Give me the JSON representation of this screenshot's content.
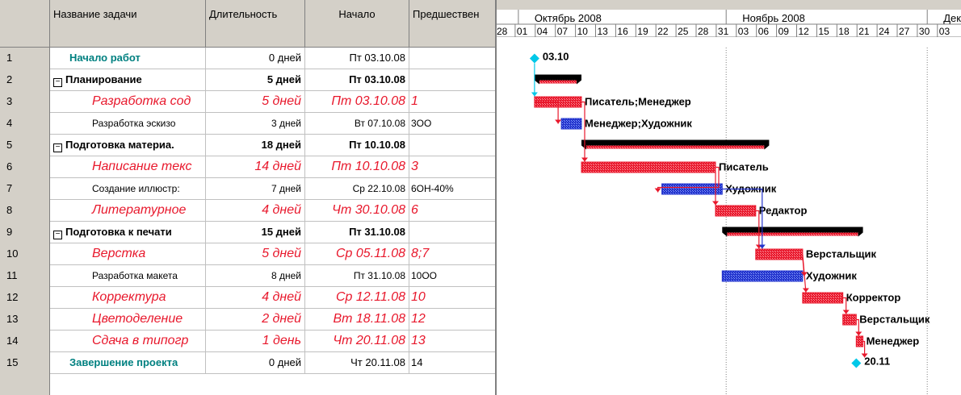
{
  "columns": {
    "name": "Название задачи",
    "duration": "Длительность",
    "start": "Начало",
    "predecessors": "Предшествен"
  },
  "tasks": [
    {
      "id": "1",
      "name": "Начало работ",
      "duration": "0 дней",
      "start": "Пт 03.10.08",
      "pred": "",
      "kind": "milestone"
    },
    {
      "id": "2",
      "name": "Планирование",
      "duration": "5 дней",
      "start": "Пт 03.10.08",
      "pred": "",
      "kind": "summary"
    },
    {
      "id": "3",
      "name": "Разработка сод",
      "duration": "5 дней",
      "start": "Пт 03.10.08",
      "pred": "1",
      "kind": "critical"
    },
    {
      "id": "4",
      "name": "Разработка эскизо",
      "duration": "3 дней",
      "start": "Вт 07.10.08",
      "pred": "3ОО",
      "kind": "normal"
    },
    {
      "id": "5",
      "name": "Подготовка материа.",
      "duration": "18 дней",
      "start": "Пт 10.10.08",
      "pred": "",
      "kind": "summary"
    },
    {
      "id": "6",
      "name": "Написание текс",
      "duration": "14 дней",
      "start": "Пт 10.10.08",
      "pred": "3",
      "kind": "critical"
    },
    {
      "id": "7",
      "name": "Создание иллюстр:",
      "duration": "7 дней",
      "start": "Ср 22.10.08",
      "pred": "6ОН-40%",
      "kind": "normal"
    },
    {
      "id": "8",
      "name": "Литературное",
      "duration": "4 дней",
      "start": "Чт 30.10.08",
      "pred": "6",
      "kind": "critical"
    },
    {
      "id": "9",
      "name": "Подготовка к печати",
      "duration": "15 дней",
      "start": "Пт 31.10.08",
      "pred": "",
      "kind": "summary"
    },
    {
      "id": "10",
      "name": "Верстка",
      "duration": "5 дней",
      "start": "Ср 05.11.08",
      "pred": "8;7",
      "kind": "critical"
    },
    {
      "id": "11",
      "name": "Разработка макета",
      "duration": "8 дней",
      "start": "Пт 31.10.08",
      "pred": "10ОО",
      "kind": "normal"
    },
    {
      "id": "12",
      "name": "Корректура",
      "duration": "4 дней",
      "start": "Ср 12.11.08",
      "pred": "10",
      "kind": "critical"
    },
    {
      "id": "13",
      "name": "Цветоделение",
      "duration": "2 дней",
      "start": "Вт 18.11.08",
      "pred": "12",
      "kind": "critical"
    },
    {
      "id": "14",
      "name": "Сдача в типогр",
      "duration": "1 день",
      "start": "Чт 20.11.08",
      "pred": "13",
      "kind": "critical"
    },
    {
      "id": "15",
      "name": "Завершение проекта",
      "duration": "0 дней",
      "start": "Чт 20.11.08",
      "pred": "14",
      "kind": "milestone"
    }
  ],
  "timescale": {
    "months": [
      "Октябрь 2008",
      "Ноябрь 2008",
      "Дек"
    ],
    "days": [
      "28",
      "01",
      "04",
      "07",
      "10",
      "13",
      "16",
      "19",
      "22",
      "25",
      "28",
      "31",
      "03",
      "06",
      "09",
      "12",
      "15",
      "18",
      "21",
      "24",
      "27",
      "30",
      "03"
    ]
  },
  "bars": [
    {
      "row": 0,
      "type": "milestone",
      "start": 3,
      "label": "03.10"
    },
    {
      "row": 1,
      "type": "summary",
      "start": 3,
      "end": 10
    },
    {
      "row": 2,
      "type": "critical",
      "start": 3,
      "end": 10,
      "label": "Писатель;Менеджер"
    },
    {
      "row": 3,
      "type": "normal",
      "start": 7,
      "end": 10,
      "label": "Менеджер;Художник"
    },
    {
      "row": 4,
      "type": "summary",
      "start": 10,
      "end": 38
    },
    {
      "row": 5,
      "type": "critical",
      "start": 10,
      "end": 30,
      "label": "Писатель"
    },
    {
      "row": 6,
      "type": "normal",
      "start": 22,
      "end": 31,
      "label": "Художник"
    },
    {
      "row": 7,
      "type": "critical",
      "start": 30,
      "end": 36,
      "label": "Редактор"
    },
    {
      "row": 8,
      "type": "summary",
      "start": 31,
      "end": 52
    },
    {
      "row": 9,
      "type": "critical",
      "start": 36,
      "end": 43,
      "label": "Верстальщик"
    },
    {
      "row": 10,
      "type": "normal",
      "start": 31,
      "end": 43,
      "label": "Художник"
    },
    {
      "row": 11,
      "type": "critical",
      "start": 43,
      "end": 49,
      "label": "Корректор"
    },
    {
      "row": 12,
      "type": "critical",
      "start": 49,
      "end": 51,
      "label": "Верстальщик"
    },
    {
      "row": 13,
      "type": "critical",
      "start": 51,
      "end": 52,
      "label": "Менеджер"
    },
    {
      "row": 14,
      "type": "milestone",
      "start": 51,
      "label": "20.11"
    }
  ],
  "colors": {
    "critical": "#e8182c",
    "normal": "#2233cc",
    "summary": "#000000",
    "milestone": "#00c8e8",
    "milestone_text": "#008080"
  }
}
